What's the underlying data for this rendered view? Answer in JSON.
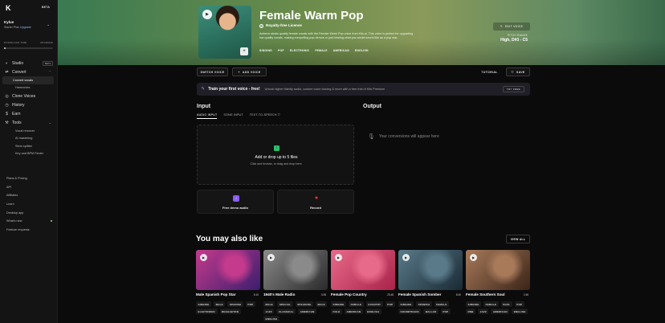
{
  "sidebar": {
    "logo": "K",
    "beta": "BETA",
    "user_name": "Kylue",
    "plan": "Starter Plan",
    "upgrade": "Upgrade",
    "download_label": "DOWNLOAD TIME",
    "download_value": "UPGRADE",
    "download_progress": 0.03,
    "nav": [
      {
        "label": "Studio",
        "tag": "BETA"
      },
      {
        "label": "Convert"
      },
      {
        "label": "Clone Voices"
      },
      {
        "label": "History"
      },
      {
        "label": "Earn"
      },
      {
        "label": "Tools"
      }
    ],
    "convert_sub": [
      "Convert vocals",
      "Harmonies"
    ],
    "tools_sub": [
      "Vocal remover",
      "AI mastering",
      "Stem splitter",
      "Key and BPM Finder"
    ],
    "footer": [
      "Plans & Pricing",
      "API",
      "Affiliates",
      "Learn",
      "Desktop app",
      "What's new",
      "Feature requests"
    ]
  },
  "hero": {
    "title": "Female Warm Pop",
    "license": "Royalty-free License",
    "description": "Achieve studio quality female vocals with the Female Warm Pop voice from Kits.ai. This voice is perfect for upgrading low quality vocals, making compelling pop demos or just hearing what you would sound like as a pop star.",
    "tags": [
      "SINGING",
      "POP",
      "ELECTRONIC",
      "FEMALE",
      "AMERICAN",
      "ENGLISH"
    ],
    "edit_voice": "EDIT VOICE",
    "pitch_label": "PITCH RANGE",
    "pitch_value": "High, D#3 - C5"
  },
  "toolbar": {
    "switch": "SWITCH VOICE",
    "add": "ADD VOICE",
    "tutorial": "TUTORIAL",
    "save": "SAVE"
  },
  "banner": {
    "title": "Train your first voice - free!",
    "desc": "Unlock higher fidelity audio, custom voice cloning & more with a free trial of Kits Premium",
    "button": "TRY FREE"
  },
  "input": {
    "heading": "Input",
    "tabs": [
      "AUDIO INPUT",
      "SONG INPUT",
      "TEXT-TO-SPEECH"
    ],
    "drop_title": "Add or drop up to 5 files",
    "drop_sub": "Click and browse, or drag and drop here.",
    "demo": "Free demo audio",
    "record": "Record"
  },
  "output": {
    "heading": "Output",
    "placeholder": "Your conversions will appear here"
  },
  "also": {
    "heading": "You may also like",
    "view_all": "VIEW ALL",
    "cards": [
      {
        "title": "Male Spanish Pop Star",
        "dur": "5:10",
        "tags": [
          "SINGING",
          "MALE",
          "SPANISH",
          "POP",
          "ELECTRONIC",
          "REGGAETON"
        ],
        "c1": "#c43a8c",
        "c2": "#3b1e6e"
      },
      {
        "title": "1940's Male Radio",
        "dur": "3:38",
        "tags": [
          "MALE",
          "SPECIAL",
          "SPEAKING",
          "MALE",
          "JAZZ",
          "CLASSICAL",
          "AMERICAN",
          "ENGLISH"
        ],
        "c1": "#8a8a8a",
        "c2": "#2a2a2a"
      },
      {
        "title": "Female Pop Country",
        "dur": "23:48",
        "tags": [
          "SINGING",
          "FEMALE",
          "COUNTRY",
          "POP",
          "FOLK",
          "AMERICAN",
          "ENGLISH"
        ],
        "c1": "#e86a8a",
        "c2": "#a8234a"
      },
      {
        "title": "Female Spanish Somber",
        "dur": "8:40",
        "tags": [
          "SINGING",
          "SPANISH",
          "FEMALE",
          "SOUNDTRACK",
          "BALLAD",
          "POP"
        ],
        "c1": "#5a7a8a",
        "c2": "#1a2a34"
      },
      {
        "title": "Female Southern Soul",
        "dur": "1:56",
        "tags": [
          "SINGING",
          "FEMALE",
          "SOUL",
          "POP",
          "RNB",
          "JAZZ",
          "AMERICAN",
          "ENGLISH"
        ],
        "c1": "#a87a5a",
        "c2": "#3a2418"
      }
    ]
  }
}
